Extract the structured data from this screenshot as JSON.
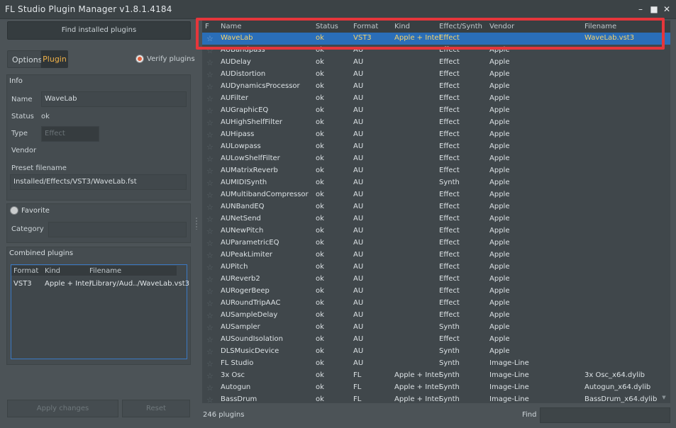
{
  "window": {
    "title": "FL Studio Plugin Manager v1.8.1.4184",
    "minimize_icon": "minimize-icon",
    "maximize_icon": "maximize-icon",
    "close_icon": "close-icon"
  },
  "left": {
    "find_button": "Find installed plugins",
    "tabs": [
      "Options",
      "Plugin"
    ],
    "active_tab": "Plugin",
    "verify_label": "Verify plugins",
    "verify_checked": true,
    "info": {
      "title": "Info",
      "name_label": "Name",
      "name_value": "WaveLab",
      "status_label": "Status",
      "status_value": "ok",
      "type_label": "Type",
      "type_value": "Effect",
      "vendor_label": "Vendor",
      "preset_label": "Preset filename",
      "preset_value": "Installed/Effects/VST3/WaveLab.fst"
    },
    "favorite": {
      "label": "Favorite",
      "checked": false,
      "category_label": "Category",
      "category_value": ""
    },
    "combined": {
      "title": "Combined plugins",
      "headers": [
        "Format",
        "Kind",
        "Filename"
      ],
      "row": [
        "VST3",
        "Apple + Intel",
        "/Library/Aud../WaveLab.vst3"
      ]
    },
    "apply_button": "Apply changes",
    "reset_button": "Reset"
  },
  "list": {
    "headers": [
      "F",
      "Name",
      "Status",
      "Format",
      "Kind",
      "Effect/Synth",
      "Vendor",
      "Filename"
    ],
    "rows": [
      [
        "WaveLab",
        "ok",
        "VST3",
        "Apple + Intel",
        "Effect",
        "",
        "WaveLab.vst3"
      ],
      [
        "AUBandpass",
        "ok",
        "AU",
        "",
        "Effect",
        "Apple",
        ""
      ],
      [
        "AUDelay",
        "ok",
        "AU",
        "",
        "Effect",
        "Apple",
        ""
      ],
      [
        "AUDistortion",
        "ok",
        "AU",
        "",
        "Effect",
        "Apple",
        ""
      ],
      [
        "AUDynamicsProcessor",
        "ok",
        "AU",
        "",
        "Effect",
        "Apple",
        ""
      ],
      [
        "AUFilter",
        "ok",
        "AU",
        "",
        "Effect",
        "Apple",
        ""
      ],
      [
        "AUGraphicEQ",
        "ok",
        "AU",
        "",
        "Effect",
        "Apple",
        ""
      ],
      [
        "AUHighShelfFilter",
        "ok",
        "AU",
        "",
        "Effect",
        "Apple",
        ""
      ],
      [
        "AUHipass",
        "ok",
        "AU",
        "",
        "Effect",
        "Apple",
        ""
      ],
      [
        "AULowpass",
        "ok",
        "AU",
        "",
        "Effect",
        "Apple",
        ""
      ],
      [
        "AULowShelfFilter",
        "ok",
        "AU",
        "",
        "Effect",
        "Apple",
        ""
      ],
      [
        "AUMatrixReverb",
        "ok",
        "AU",
        "",
        "Effect",
        "Apple",
        ""
      ],
      [
        "AUMIDISynth",
        "ok",
        "AU",
        "",
        "Synth",
        "Apple",
        ""
      ],
      [
        "AUMultibandCompressor",
        "ok",
        "AU",
        "",
        "Effect",
        "Apple",
        ""
      ],
      [
        "AUNBandEQ",
        "ok",
        "AU",
        "",
        "Effect",
        "Apple",
        ""
      ],
      [
        "AUNetSend",
        "ok",
        "AU",
        "",
        "Effect",
        "Apple",
        ""
      ],
      [
        "AUNewPitch",
        "ok",
        "AU",
        "",
        "Effect",
        "Apple",
        ""
      ],
      [
        "AUParametricEQ",
        "ok",
        "AU",
        "",
        "Effect",
        "Apple",
        ""
      ],
      [
        "AUPeakLimiter",
        "ok",
        "AU",
        "",
        "Effect",
        "Apple",
        ""
      ],
      [
        "AUPitch",
        "ok",
        "AU",
        "",
        "Effect",
        "Apple",
        ""
      ],
      [
        "AUReverb2",
        "ok",
        "AU",
        "",
        "Effect",
        "Apple",
        ""
      ],
      [
        "AURogerBeep",
        "ok",
        "AU",
        "",
        "Effect",
        "Apple",
        ""
      ],
      [
        "AURoundTripAAC",
        "ok",
        "AU",
        "",
        "Effect",
        "Apple",
        ""
      ],
      [
        "AUSampleDelay",
        "ok",
        "AU",
        "",
        "Effect",
        "Apple",
        ""
      ],
      [
        "AUSampler",
        "ok",
        "AU",
        "",
        "Synth",
        "Apple",
        ""
      ],
      [
        "AUSoundIsolation",
        "ok",
        "AU",
        "",
        "Effect",
        "Apple",
        ""
      ],
      [
        "DLSMusicDevice",
        "ok",
        "AU",
        "",
        "Synth",
        "Apple",
        ""
      ],
      [
        "FL Studio",
        "ok",
        "AU",
        "",
        "Synth",
        "Image-Line",
        ""
      ],
      [
        "3x Osc",
        "ok",
        "FL",
        "Apple + Intel",
        "Synth",
        "Image-Line",
        "3x Osc_x64.dylib"
      ],
      [
        "Autogun",
        "ok",
        "FL",
        "Apple + Intel",
        "Synth",
        "Image-Line",
        "Autogun_x64.dylib"
      ],
      [
        "BassDrum",
        "ok",
        "FL",
        "Apple + Intel",
        "Synth",
        "Image-Line",
        "BassDrum_x64.dylib"
      ]
    ],
    "selected_index": 0,
    "count_label": "246 plugins",
    "find_label": "Find",
    "find_value": ""
  },
  "colors": {
    "selection": "#2a6eb8",
    "selected_text": "#f3d26d",
    "active_tab_text": "#f0b249",
    "highlight_border": "#e5363b"
  }
}
